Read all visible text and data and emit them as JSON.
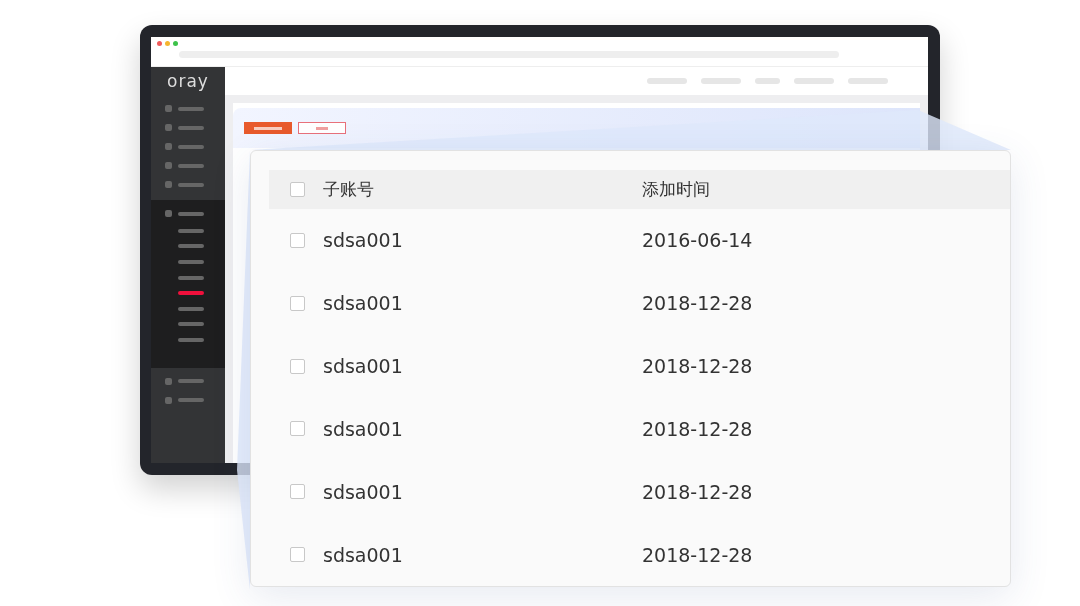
{
  "logo": "oray",
  "sidebar": {
    "top_items": [
      {
        "selected": false
      },
      {
        "selected": false
      },
      {
        "selected": false
      },
      {
        "selected": false
      },
      {
        "selected": false
      }
    ],
    "group": {
      "expanded": true,
      "children": [
        {
          "selected": false
        },
        {
          "selected": false
        },
        {
          "selected": false
        },
        {
          "selected": false
        },
        {
          "selected": true
        },
        {
          "selected": false
        },
        {
          "selected": false
        },
        {
          "selected": false
        }
      ]
    },
    "bottom_items": [
      {
        "selected": false
      },
      {
        "selected": false
      }
    ]
  },
  "table": {
    "header_checked": false,
    "columns": [
      "子账号",
      "添加时间"
    ],
    "rows": [
      {
        "checked": false,
        "cells": [
          "sdsa001",
          "2016-06-14"
        ]
      },
      {
        "checked": false,
        "cells": [
          "sdsa001",
          "2018-12-28"
        ]
      },
      {
        "checked": false,
        "cells": [
          "sdsa001",
          "2018-12-28"
        ]
      },
      {
        "checked": false,
        "cells": [
          "sdsa001",
          "2018-12-28"
        ]
      },
      {
        "checked": false,
        "cells": [
          "sdsa001",
          "2018-12-28"
        ]
      },
      {
        "checked": false,
        "cells": [
          "sdsa001",
          "2018-12-28"
        ]
      }
    ]
  }
}
